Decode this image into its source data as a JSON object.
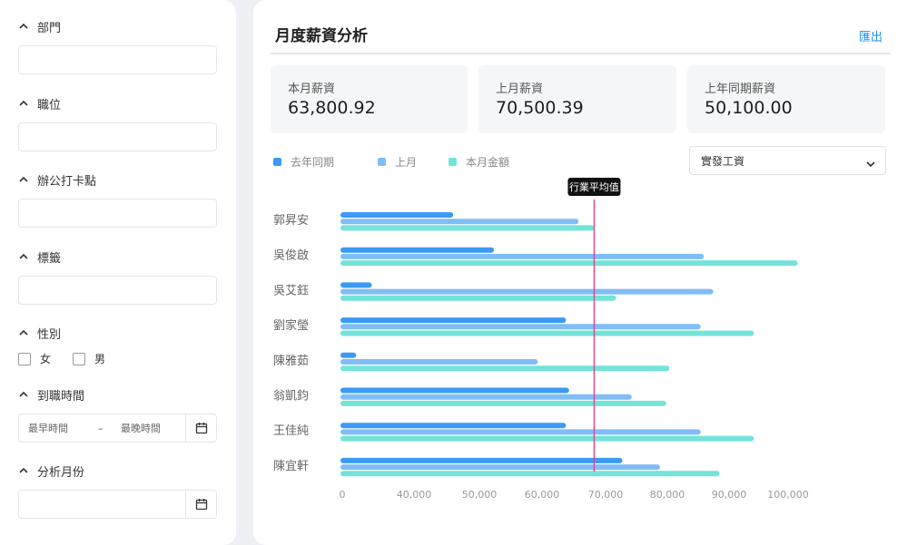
{
  "filters": {
    "department": {
      "label": "部門",
      "value": ""
    },
    "position": {
      "label": "職位",
      "value": ""
    },
    "office": {
      "label": "辦公打卡點",
      "value": ""
    },
    "tags": {
      "label": "標籤",
      "value": ""
    },
    "gender": {
      "label": "性別",
      "options": [
        "女",
        "男"
      ]
    },
    "hire_date": {
      "label": "到職時間",
      "start_placeholder": "最早時間",
      "separator": "–",
      "end_placeholder": "最晚時間"
    },
    "month": {
      "label": "分析月份",
      "value": ""
    }
  },
  "main": {
    "title": "月度薪資分析",
    "export_label": "匯出",
    "cards": [
      {
        "label": "本月薪資",
        "value": "63,800.92"
      },
      {
        "label": "上月薪資",
        "value": "70,500.39"
      },
      {
        "label": "上年同期薪資",
        "value": "50,100.00"
      }
    ],
    "salary_type": "實發工資"
  },
  "colors": {
    "accent": "#1a8cff",
    "avg_line": "#e0468c"
  },
  "chart_data": {
    "type": "bar",
    "orientation": "horizontal",
    "categories": [
      "郭昇安",
      "吳俊啟",
      "吳艾鈺",
      "劉家瑩",
      "陳雅茹",
      "翁凱鈞",
      "王佳純",
      "陳宜軒"
    ],
    "series": [
      {
        "name": "去年同期",
        "color": "#3a9af5",
        "values": [
          18000,
          24500,
          5000,
          36000,
          2500,
          36500,
          36000,
          45000
        ]
      },
      {
        "name": "上月",
        "color": "#80bdf7",
        "values": [
          38000,
          58000,
          59500,
          57500,
          31500,
          46500,
          57500,
          51000
        ]
      },
      {
        "name": "本月金額",
        "color": "#74e3d9",
        "values": [
          40500,
          73000,
          44000,
          66000,
          52500,
          52000,
          66000,
          60500
        ]
      }
    ],
    "xlim": [
      0,
      100000
    ],
    "xticks": [
      "0",
      "40,000",
      "50,000",
      "60,000",
      "70,000",
      "80,000",
      "90,000",
      "100,000"
    ],
    "reference_line": {
      "label": "行業平均值",
      "value": 40500
    },
    "legend_position": "top-left",
    "grid": false
  }
}
